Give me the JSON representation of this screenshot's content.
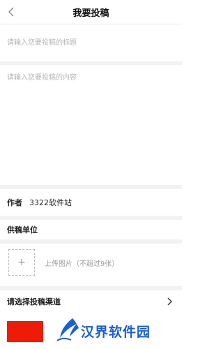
{
  "header": {
    "title": "我要投稿"
  },
  "form": {
    "title_placeholder": "请输入您要投稿的标题",
    "content_placeholder": "请输入您要投稿的内容",
    "author_label": "作者",
    "author_value": "3322软件站",
    "supplier_label": "供稿单位",
    "upload_icon": "+",
    "upload_label": "上传图片（不超过9张）",
    "channel_label": "请选择投稿渠道"
  },
  "watermark": {
    "text": "汉界软件园"
  },
  "colors": {
    "accent_red": "#ee1b06",
    "logo_blue": "#1b5fd1"
  }
}
